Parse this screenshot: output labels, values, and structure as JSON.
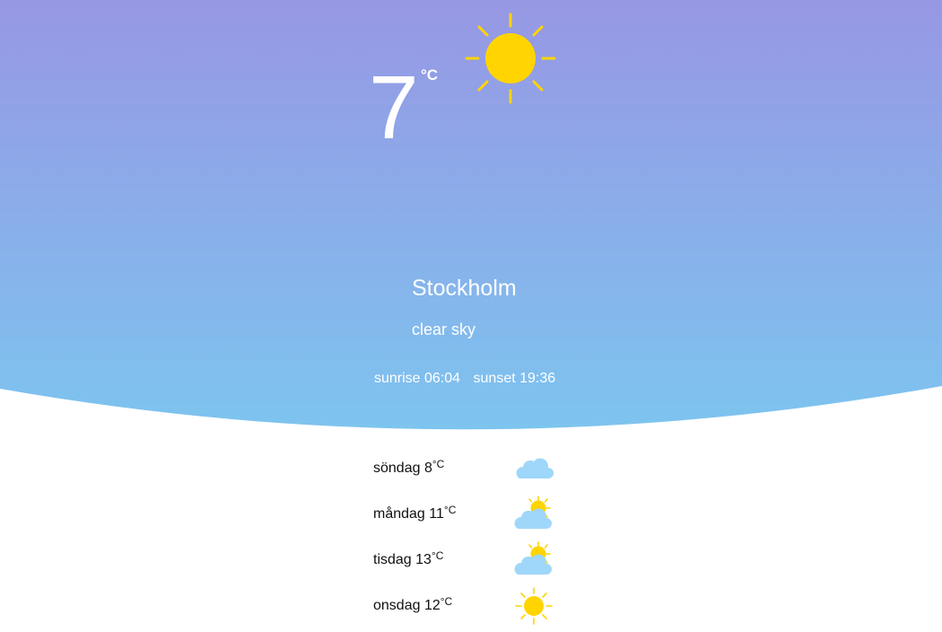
{
  "current": {
    "temperature": "7",
    "unit": "°C",
    "icon": "sun-icon",
    "city": "Stockholm",
    "description": "clear sky",
    "sunrise": "sunrise 06:04",
    "sunset": "sunset 19:36"
  },
  "forecast": [
    {
      "day": "söndag",
      "temp": "8",
      "unit": "°C",
      "icon": "cloud-icon"
    },
    {
      "day": "måndag",
      "temp": "11",
      "unit": "°C",
      "icon": "partly-cloudy-icon"
    },
    {
      "day": "tisdag",
      "temp": "13",
      "unit": "°C",
      "icon": "partly-cloudy-icon"
    },
    {
      "day": "onsdag",
      "temp": "12",
      "unit": "°C",
      "icon": "sun-icon"
    }
  ],
  "colors": {
    "gradient_top": "#9797e4",
    "gradient_bottom": "#7dc4ef",
    "sun": "#ffd400",
    "cloud": "#9fd7fa"
  }
}
